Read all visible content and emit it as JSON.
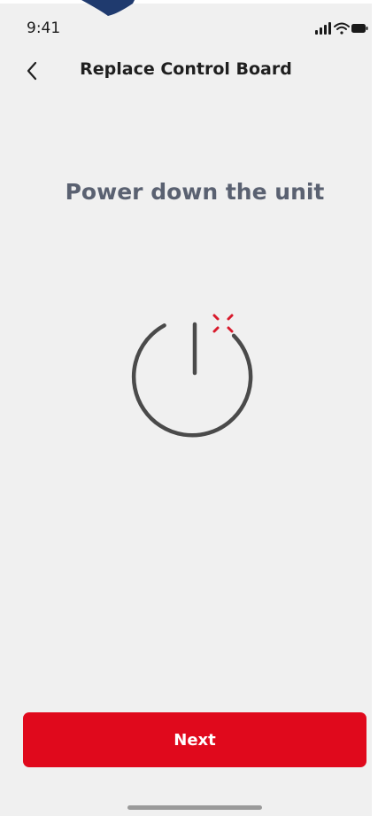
{
  "status_bar": {
    "time": "9:41",
    "icons": [
      "signal-icon",
      "wifi-icon",
      "battery-icon"
    ]
  },
  "nav": {
    "back_icon": "chevron-left-icon",
    "title": "Replace Control Board"
  },
  "main": {
    "heading": "Power down the unit",
    "illustration": "power-icon"
  },
  "footer": {
    "next_label": "Next"
  },
  "colors": {
    "background": "#f0f0f0",
    "primary": "#e0091c",
    "heading": "#5a6171",
    "icon_stroke": "#4a4a4a"
  }
}
